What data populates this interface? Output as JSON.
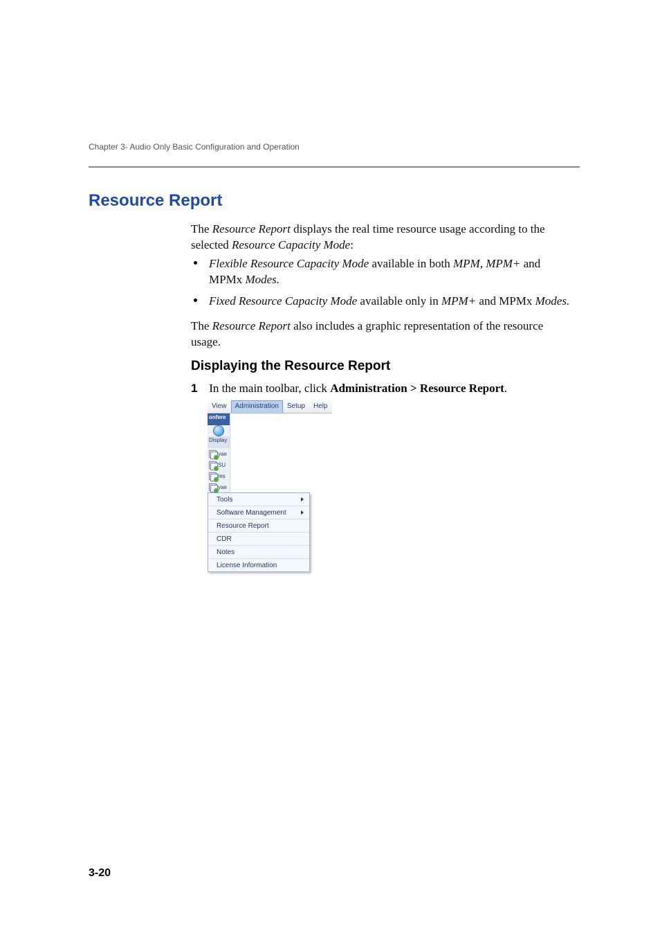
{
  "running_head": "Chapter 3- Audio Only Basic Configuration and Operation",
  "section_title": "Resource Report",
  "para1": {
    "pre": "The ",
    "i1": "Resource Report",
    "mid": " displays the real time resource usage according to the selected ",
    "i2": "Resource Capacity Mode",
    "post": ":"
  },
  "bullets": [
    {
      "i1": "Flexible Resource Capacity Mode",
      "mid": " available in both ",
      "i2": "MPM",
      "mid2": ",  ",
      "i3": "MPM+",
      "mid3": " and MPMx ",
      "i4": "Modes.",
      "post": ""
    },
    {
      "i1": "Fixed Resource Capacity Mode",
      "mid": " available only in ",
      "i2": "MPM+",
      "mid2": " and MPMx ",
      "i3": "Modes.",
      "mid3": "",
      "i4": "",
      "post": ""
    }
  ],
  "para2": {
    "pre": "The ",
    "i1": "Resource Report",
    "post": " also includes a graphic representation of the resource usage."
  },
  "subsection": "Displaying the Resource Report",
  "step": {
    "num": "1",
    "pre": "In the main toolbar, click ",
    "bold": "Administration > Resource Report",
    "post": "."
  },
  "menubar": {
    "view": "View",
    "admin": "Administration",
    "setup": "Setup",
    "help": "Help"
  },
  "left_tabs": {
    "confer": "onfere",
    "display": "Display",
    "yae": "yae",
    "su": "SU",
    "tes": "tes",
    "yae2": "yae"
  },
  "dropdown": {
    "tools": "Tools",
    "software": "Software Management",
    "resource": "Resource Report",
    "cdr": "CDR",
    "notes": "Notes",
    "license": "License Information"
  },
  "page_num": "3-20"
}
